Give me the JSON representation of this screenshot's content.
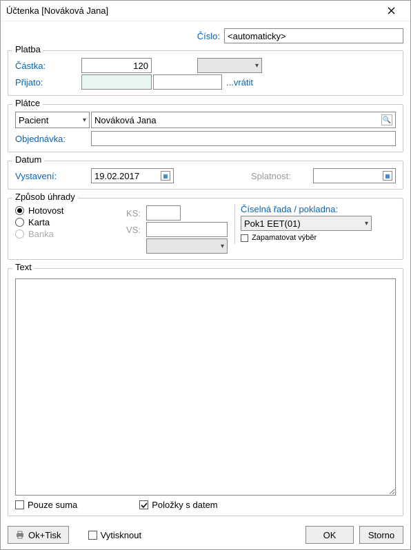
{
  "titlebar": {
    "title": "Účtenka  [Nováková Jana]"
  },
  "number": {
    "label": "Číslo:",
    "value": "<automaticky>"
  },
  "payment": {
    "legend": "Platba",
    "amount_label": "Částka:",
    "amount_value": "120",
    "received_label": "Přijato:",
    "received_value": "",
    "change_value": "",
    "return_link": "...vrátit"
  },
  "payer": {
    "legend": "Plátce",
    "type_value": "Pacient",
    "name_value": "Nováková Jana",
    "order_label": "Objednávka:",
    "order_value": ""
  },
  "dates": {
    "legend": "Datum",
    "issued_label": "Vystavení:",
    "issued_value": "19.02.2017",
    "due_label": "Splatnost:",
    "due_value": ""
  },
  "method": {
    "legend": "Způsob úhrady",
    "options": [
      "Hotovost",
      "Karta",
      "Banka"
    ],
    "selected": 0,
    "ks_label": "KS:",
    "ks_value": "",
    "vs_label": "VS:",
    "vs_value": "",
    "series_label": "Číselná řada / pokladna:",
    "series_value": "Pok1 EET(01)",
    "remember_label": "Zapamatovat výběr"
  },
  "text_section": {
    "legend": "Text",
    "value": ""
  },
  "options": {
    "sum_only": "Pouze suma",
    "items_with_date": "Položky s datem"
  },
  "footer": {
    "ok_print": "Ok+Tisk",
    "print_checkbox": "Vytisknout",
    "ok": "OK",
    "cancel": "Storno"
  }
}
